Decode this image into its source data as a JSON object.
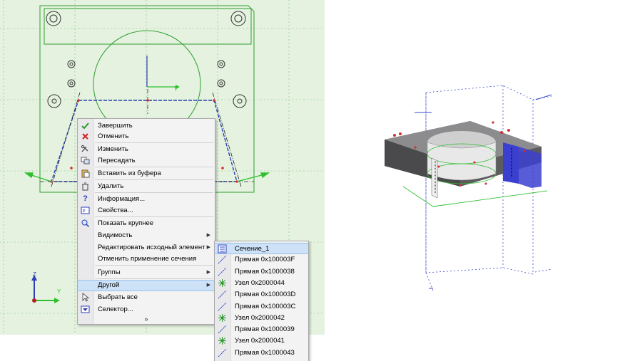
{
  "context_menu": {
    "items": [
      {
        "label": "Завершить",
        "icon": "check-icon"
      },
      {
        "label": "Отменить",
        "icon": "cancel-icon"
      },
      {
        "label": "Изменить",
        "icon": "edit-icon"
      },
      {
        "label": "Пересадать",
        "icon": "reassign-icon"
      },
      {
        "label": "Вставить из буфера",
        "icon": "paste-icon"
      },
      {
        "label": "Удалить",
        "icon": "delete-icon"
      },
      {
        "label": "Информация...",
        "icon": "help-icon"
      },
      {
        "label": "Свойства...",
        "icon": "properties-icon"
      },
      {
        "label": "Показать крупнее",
        "icon": "zoom-icon"
      },
      {
        "label": "Видимость",
        "icon": "",
        "submenu": true
      },
      {
        "label": "Редактировать исходный элемент",
        "icon": "",
        "submenu": true
      },
      {
        "label": "Отменить применение сечения",
        "icon": ""
      },
      {
        "label": "Группы",
        "icon": "",
        "submenu": true
      },
      {
        "label": "Другой",
        "icon": "",
        "submenu": true,
        "highlighted": true
      },
      {
        "label": "Выбрать все",
        "icon": "select-all-icon"
      },
      {
        "label": "Селектор...",
        "icon": "selector-icon"
      }
    ]
  },
  "submenu": {
    "items": [
      {
        "label": "Сечение_1",
        "icon": "section-icon",
        "highlighted": true
      },
      {
        "label": "Прямая 0x100003F",
        "icon": "line-icon"
      },
      {
        "label": "Прямая 0x1000038",
        "icon": "line-icon"
      },
      {
        "label": "Узел 0x2000044",
        "icon": "node-icon"
      },
      {
        "label": "Прямая 0x100003D",
        "icon": "line-icon"
      },
      {
        "label": "Прямая 0x100003C",
        "icon": "line-icon"
      },
      {
        "label": "Узел 0x2000042",
        "icon": "node-icon"
      },
      {
        "label": "Прямая 0x1000039",
        "icon": "line-icon"
      },
      {
        "label": "Узел 0x2000041",
        "icon": "node-icon"
      },
      {
        "label": "Прямая 0x1000043",
        "icon": "line-icon"
      }
    ]
  },
  "sketch": {
    "axis_y": "Y",
    "axis_z": "Z",
    "triad_y": "Y",
    "triad_z": "Z"
  },
  "colors": {
    "sketch_bg": "#e4f2df",
    "sketch_line": "#2f9e2f",
    "construction_blue": "#2a3fb8",
    "highlight": "#cde1f7"
  }
}
